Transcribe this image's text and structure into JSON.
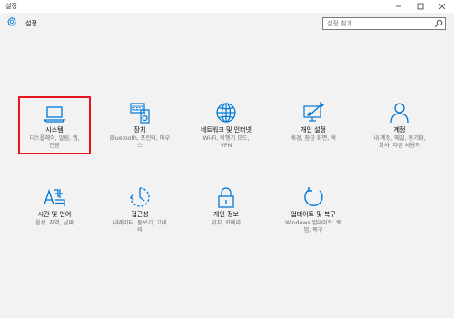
{
  "window": {
    "title": "설정"
  },
  "header": {
    "title": "설정"
  },
  "search": {
    "placeholder": "설정 찾기"
  },
  "tiles": [
    {
      "label": "시스템",
      "desc1": "디스플레이, 알림, 앱,",
      "desc2": "전원",
      "icon": "laptop-icon",
      "selected": true
    },
    {
      "label": "장치",
      "desc1": "Bluetooth, 프린터, 마우",
      "desc2": "스",
      "icon": "devices-icon"
    },
    {
      "label": "네트워크 및 인터넷",
      "desc1": "Wi-Fi, 비행기 모드,",
      "desc2": "VPN",
      "icon": "globe-icon"
    },
    {
      "label": "개인 설정",
      "desc1": "배경, 잠금 화면, 색",
      "desc2": "",
      "icon": "personalization-icon"
    },
    {
      "label": "계정",
      "desc1": "내 계정, 메일, 동기화,",
      "desc2": "회사, 다른 사용자",
      "icon": "person-icon"
    },
    {
      "label": "시간 및 언어",
      "desc1": "음성, 지역, 날짜",
      "desc2": "",
      "icon": "time-language-icon"
    },
    {
      "label": "접근성",
      "desc1": "내레이터, 돋보기, 고대",
      "desc2": "비",
      "icon": "ease-of-access-icon"
    },
    {
      "label": "개인 정보",
      "desc1": "위치, 카메라",
      "desc2": "",
      "icon": "lock-icon"
    },
    {
      "label": "업데이트 및 복구",
      "desc1": "Windows 업데이트, 백",
      "desc2": "업, 복구",
      "icon": "update-icon"
    }
  ],
  "colors": {
    "accent": "#0078d7",
    "selection": "#e8141e",
    "background": "#f2f2f2"
  }
}
